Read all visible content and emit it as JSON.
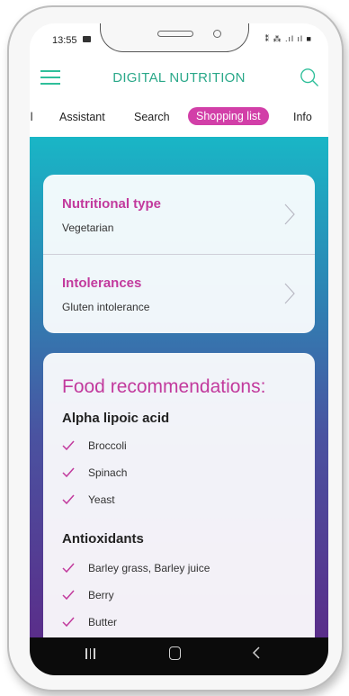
{
  "status": {
    "time": "13:55",
    "right_icons": "⁑ ⁂ .ıl ıl ■"
  },
  "header": {
    "title": "DIGITAL NUTRITION"
  },
  "tabs": [
    {
      "label": "ll"
    },
    {
      "label": "Assistant"
    },
    {
      "label": "Search"
    },
    {
      "label": "Shopping list",
      "active": true
    },
    {
      "label": "Info"
    }
  ],
  "preferences": [
    {
      "title": "Nutritional type",
      "value": "Vegetarian"
    },
    {
      "title": "Intolerances",
      "value": "Gluten intolerance"
    }
  ],
  "recommendations": {
    "title": "Food recommendations:",
    "sections": [
      {
        "heading": "Alpha lipoic acid",
        "items": [
          "Broccoli",
          "Spinach",
          "Yeast"
        ]
      },
      {
        "heading": "Antioxidants",
        "items": [
          "Barley grass, Barley juice",
          "Berry",
          "Butter"
        ]
      }
    ]
  },
  "colors": {
    "accent": "#c23a9d",
    "brand": "#2aa889",
    "active_tab": "#d23fa8"
  },
  "icons": {
    "menu": "hamburger-icon",
    "search": "search-icon",
    "chevron": "chevron-right-icon",
    "check": "check-icon"
  }
}
